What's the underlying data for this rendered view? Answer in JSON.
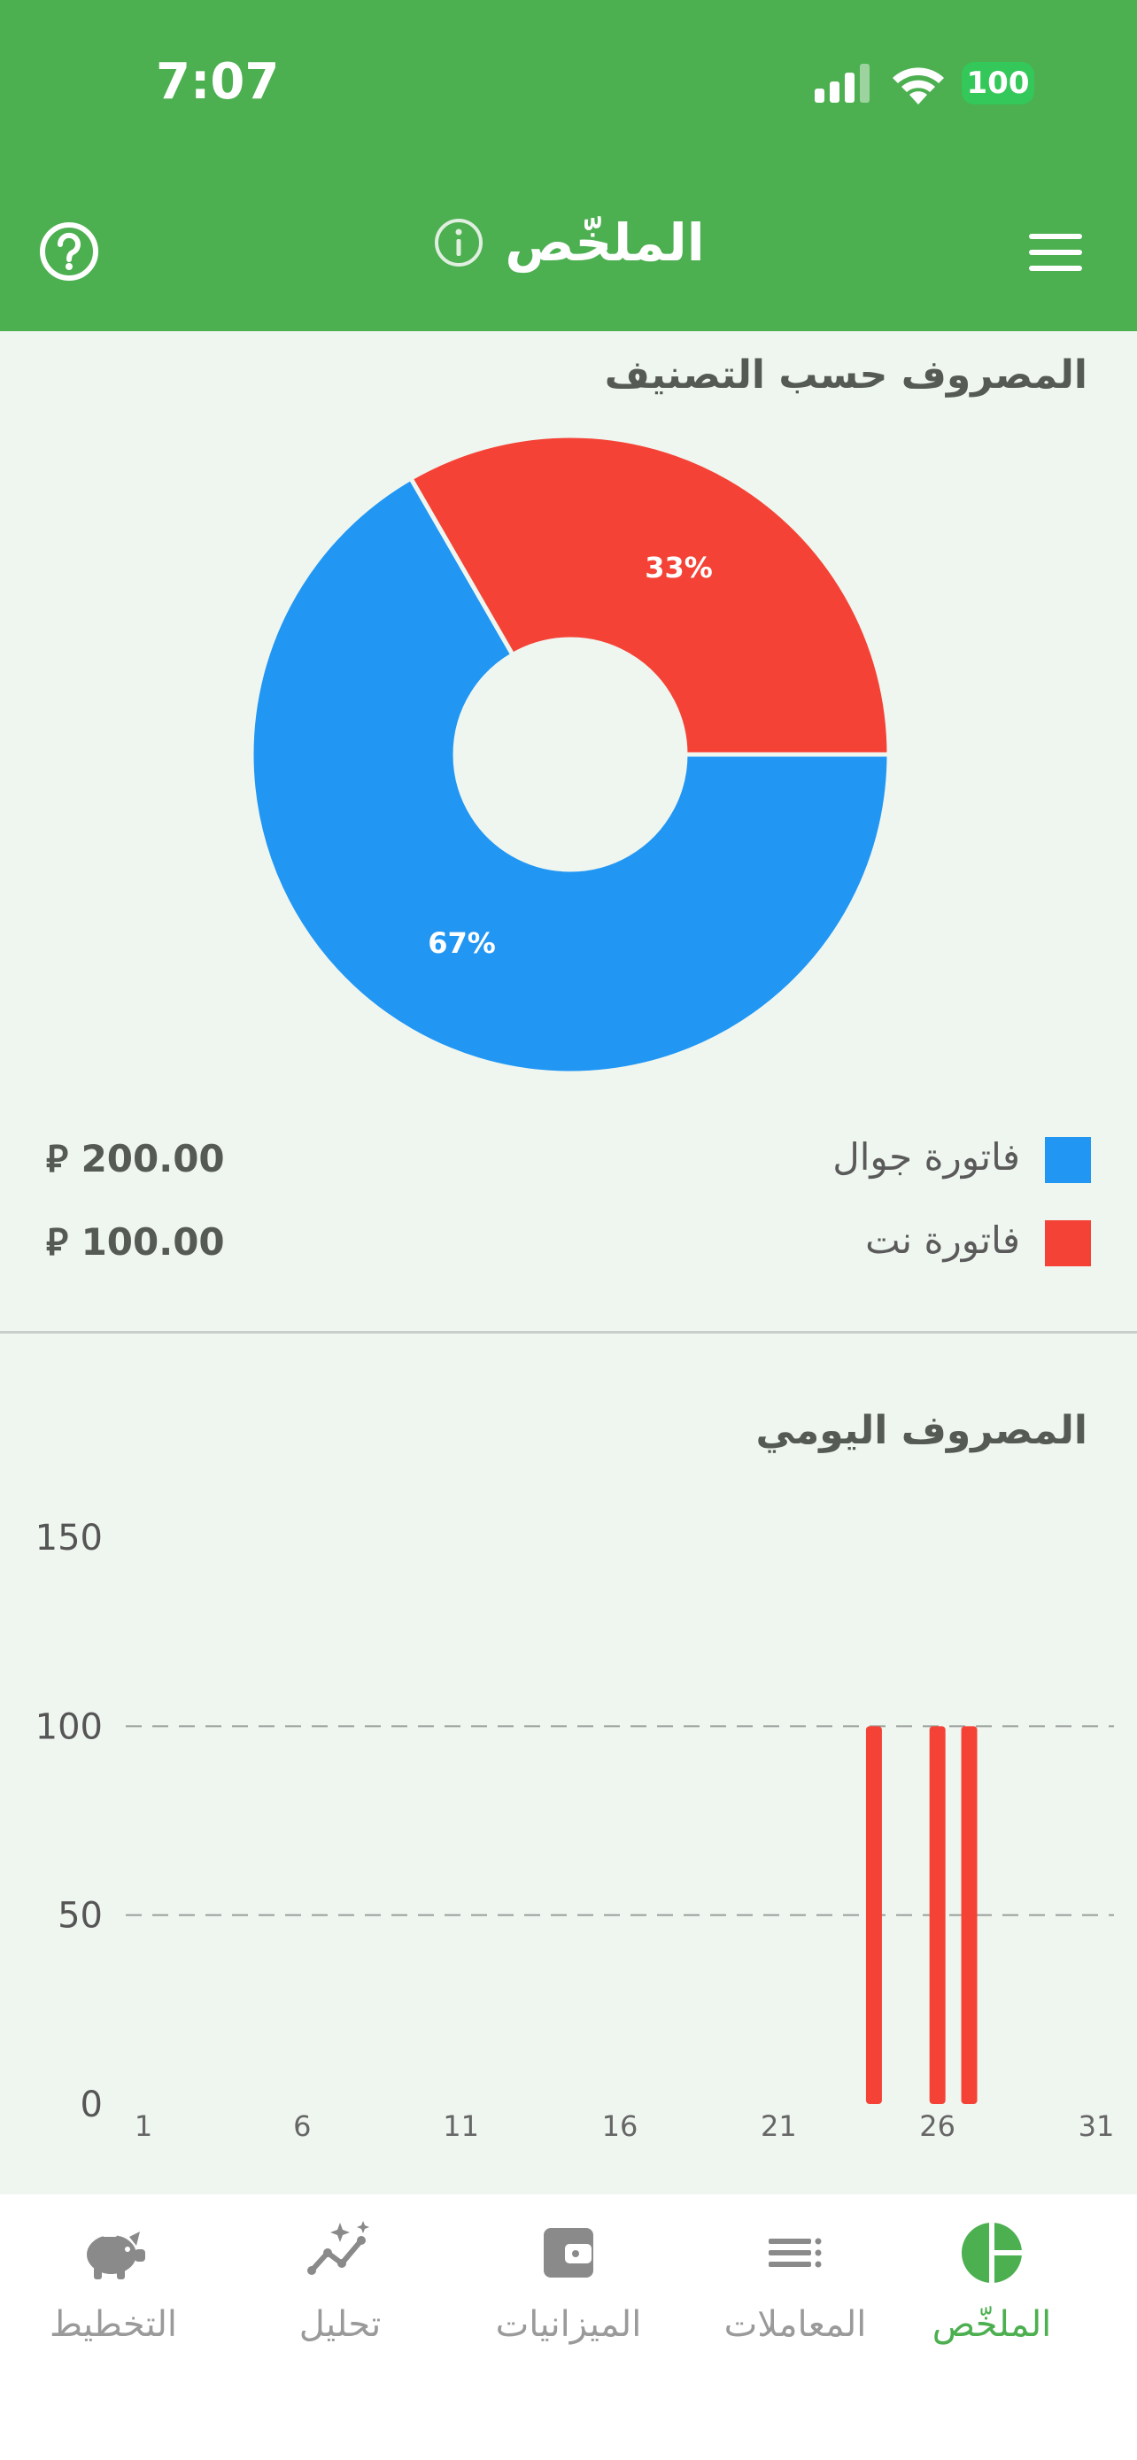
{
  "status_bar": {
    "time": "7:07",
    "battery": "100"
  },
  "header": {
    "title": "الملخّص"
  },
  "pie_section": {
    "title": "المصروف حسب التصنيف",
    "legend": [
      {
        "label": "فاتورة جوال",
        "amount": "200.00",
        "color": "#2196f3"
      },
      {
        "label": "فاتورة نت",
        "amount": "100.00",
        "color": "#f44336"
      }
    ],
    "currency_symbol": "⃁"
  },
  "bar_section": {
    "title": "المصروف اليومي"
  },
  "chart_data": [
    {
      "type": "pie",
      "title": "المصروف حسب التصنيف",
      "donut": true,
      "slices": [
        {
          "label": "فاتورة جوال",
          "value": 200,
          "percent_label": "67%",
          "color": "#2196f3"
        },
        {
          "label": "فاتورة نت",
          "value": 100,
          "percent_label": "33%",
          "color": "#f44336"
        }
      ]
    },
    {
      "type": "bar",
      "title": "المصروف اليومي",
      "x_ticks": [
        "1",
        "6",
        "11",
        "16",
        "21",
        "26",
        "31"
      ],
      "y_ticks": [
        "0",
        "50",
        "100",
        "150"
      ],
      "ylim": [
        0,
        150
      ],
      "xlim": [
        1,
        31
      ],
      "grid": "dashed at 50 and 100",
      "series": [
        {
          "color": "#f44336",
          "points": [
            {
              "x": 24,
              "y": 100
            },
            {
              "x": 26,
              "y": 100
            },
            {
              "x": 27,
              "y": 100
            }
          ]
        }
      ]
    }
  ],
  "tabbar": {
    "tabs": [
      {
        "label": "الملخّص",
        "icon": "pie-chart-icon",
        "active": true
      },
      {
        "label": "المعاملات",
        "icon": "list-icon",
        "active": false
      },
      {
        "label": "الميزانيات",
        "icon": "wallet-icon",
        "active": false
      },
      {
        "label": "تحليل",
        "icon": "trend-icon",
        "active": false
      },
      {
        "label": "التخطيط",
        "icon": "piggy-bank-icon",
        "active": false
      }
    ]
  },
  "colors": {
    "primary": "#4caf50",
    "blue": "#2196f3",
    "red": "#f44336",
    "background": "#eff6f0"
  }
}
